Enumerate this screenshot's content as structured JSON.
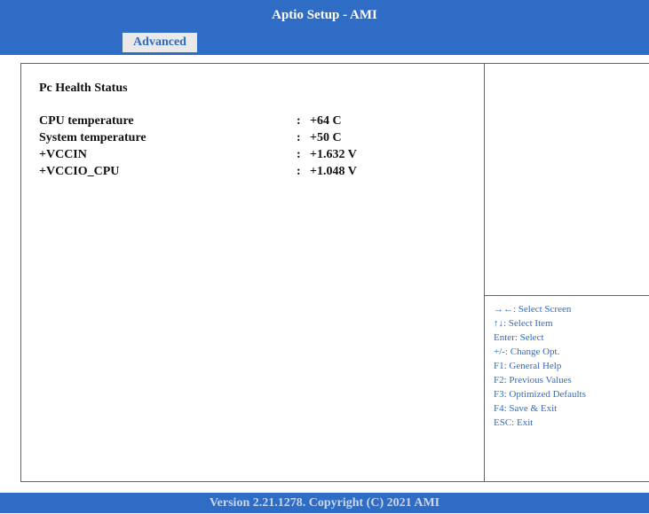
{
  "app": {
    "title": "Aptio Setup - AMI"
  },
  "tabs": [
    {
      "label": "Advanced",
      "active": true
    }
  ],
  "main": {
    "section_title": "Pc Health Status",
    "rows": [
      {
        "label": "CPU temperature",
        "sep": ":",
        "value": "+64 C"
      },
      {
        "label": "System temperature",
        "sep": ":",
        "value": "+50 C"
      },
      {
        "label": "+VCCIN",
        "sep": ":",
        "value": "+1.632 V"
      },
      {
        "label": "+VCCIO_CPU",
        "sep": ":",
        "value": "+1.048 V"
      }
    ]
  },
  "help": [
    "→←: Select Screen",
    "↑↓: Select Item",
    "Enter: Select",
    "+/-: Change Opt.",
    "F1: General Help",
    "F2: Previous Values",
    "F3: Optimized Defaults",
    "F4: Save & Exit",
    "ESC: Exit"
  ],
  "footer": {
    "version": "Version 2.21.1278. Copyright (C) 2021 AMI"
  },
  "colors": {
    "accent": "#2f6cc6",
    "tab_bg": "#e9e9e9",
    "footer_text": "#c8d6ee"
  }
}
